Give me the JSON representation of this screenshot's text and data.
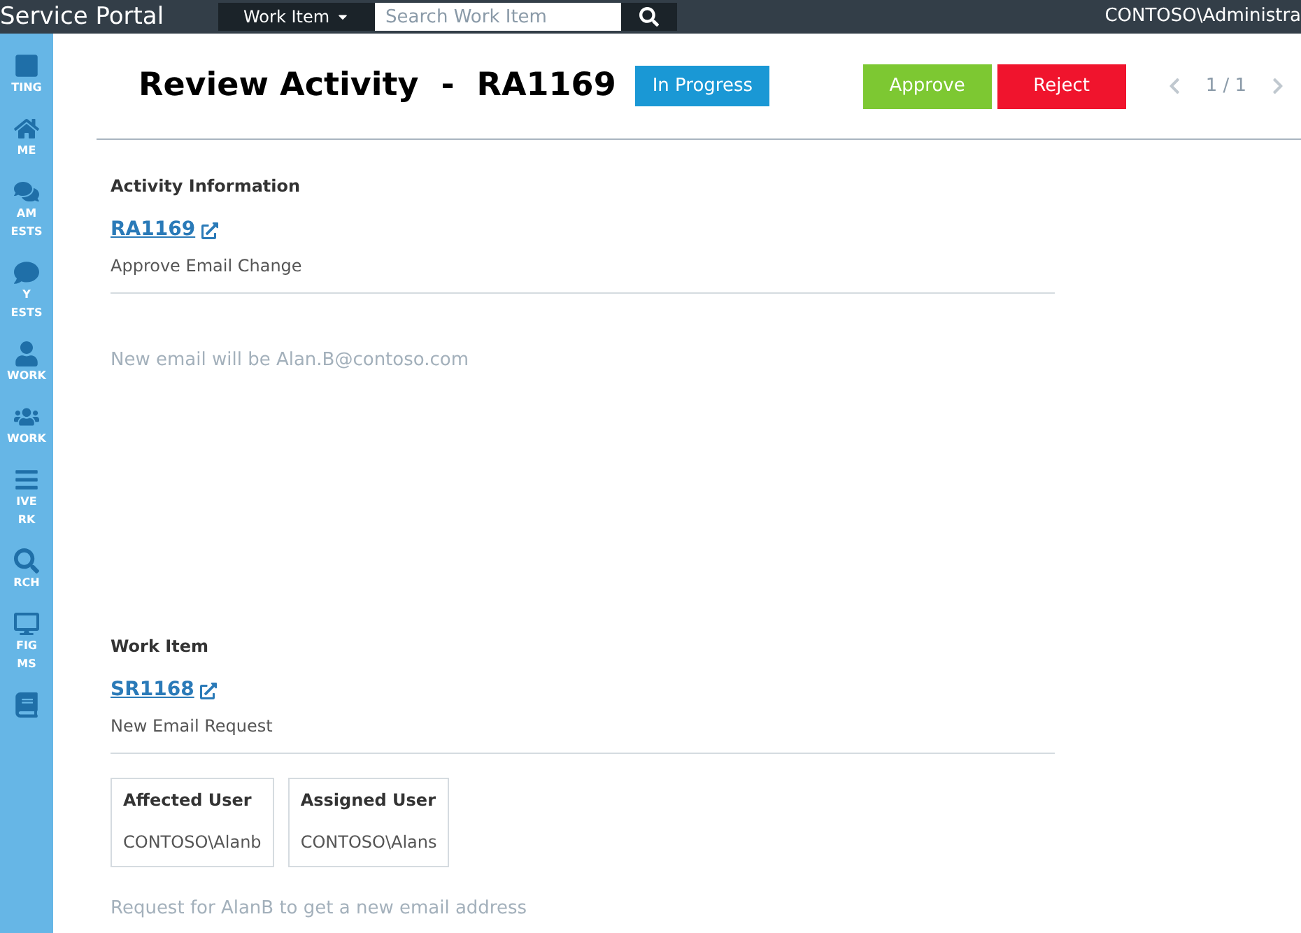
{
  "topbar": {
    "brand": "Service Portal",
    "work_item_menu": "Work Item",
    "search": {
      "placeholder": "Search Work Item"
    },
    "user": "CONTOSO\\Administra"
  },
  "sidebar": {
    "items": [
      {
        "kind": "square",
        "lines": [
          "TING"
        ]
      },
      {
        "kind": "home",
        "lines": [
          "ME"
        ]
      },
      {
        "kind": "chat",
        "lines": [
          "AM",
          "ESTS"
        ]
      },
      {
        "kind": "bubble",
        "lines": [
          "Y",
          "ESTS"
        ]
      },
      {
        "kind": "user",
        "lines": [
          "WORK"
        ]
      },
      {
        "kind": "users",
        "lines": [
          "WORK"
        ]
      },
      {
        "kind": "list",
        "lines": [
          "IVE",
          "RK"
        ]
      },
      {
        "kind": "search",
        "lines": [
          "RCH"
        ]
      },
      {
        "kind": "monitor",
        "lines": [
          "FIG",
          "MS"
        ]
      },
      {
        "kind": "book"
      }
    ]
  },
  "header": {
    "title": "Review Activity  -  RA1169",
    "status": "In Progress",
    "buttons": [
      {
        "label": "Approve",
        "kind": "approve"
      },
      {
        "label": "Reject",
        "kind": "reject"
      }
    ],
    "pager": "1 / 1"
  },
  "activity": {
    "heading": "Activity Information",
    "id": "RA1169",
    "title": "Approve Email Change",
    "description": "New email will be Alan.B@contoso.com"
  },
  "work_item": {
    "heading": "Work Item",
    "id": "SR1168",
    "title": "New Email Request",
    "cards": [
      {
        "label": "Affected User",
        "value": "CONTOSO\\Alanb"
      },
      {
        "label": "Assigned User",
        "value": "CONTOSO\\Alans"
      }
    ],
    "description": "Request for AlanB to get a new email address"
  }
}
